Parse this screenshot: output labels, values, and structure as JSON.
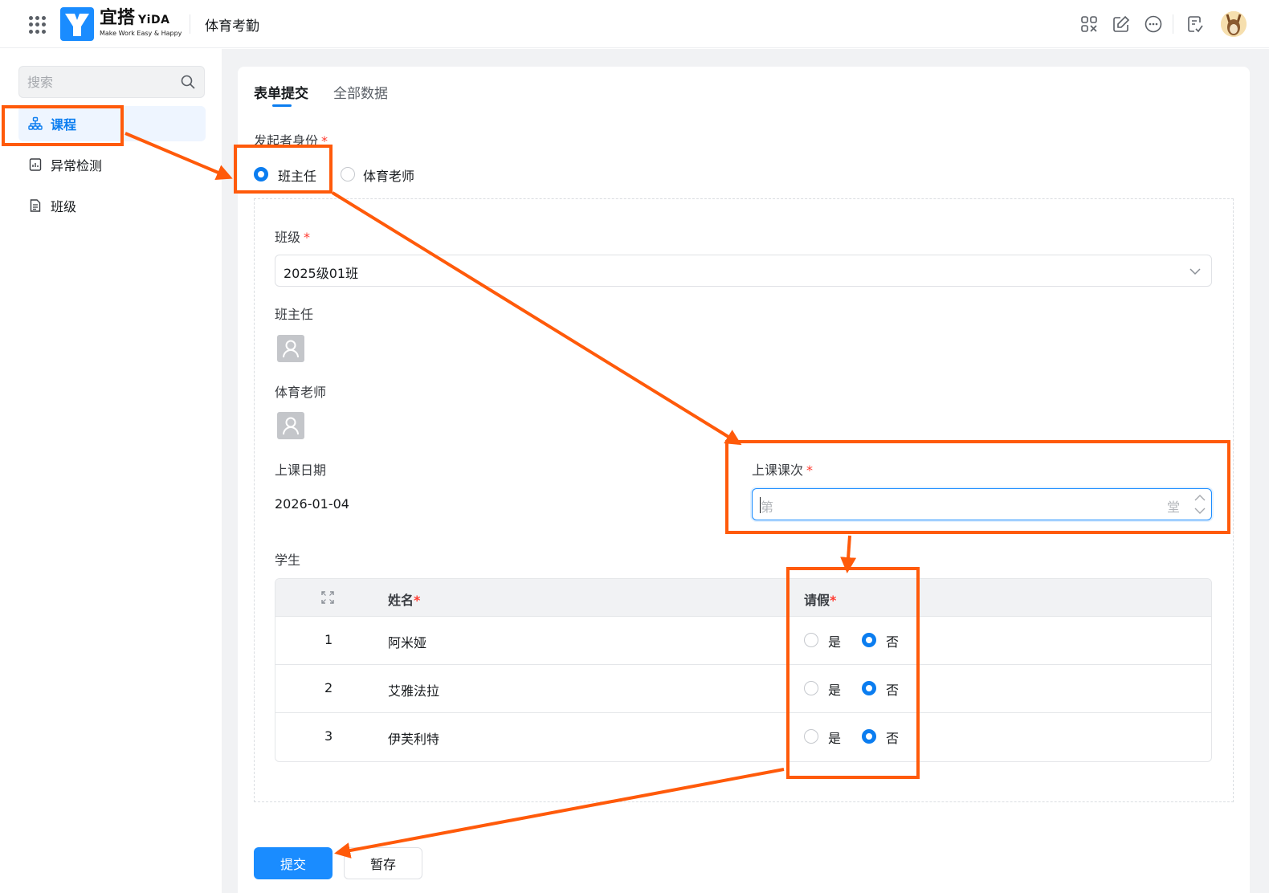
{
  "header": {
    "logo_cn": "宜搭",
    "logo_en": "YiDA",
    "logo_slogan": "Make Work Easy & Happy",
    "app_title": "体育考勤",
    "icons": [
      "grid-apps-icon",
      "qr-scan-icon",
      "edit-icon",
      "more-icon",
      "todo-icon",
      "avatar"
    ]
  },
  "sidebar": {
    "search_placeholder": "搜索",
    "items": [
      {
        "label": "课程",
        "icon": "org-chart-icon",
        "active": true
      },
      {
        "label": "异常检测",
        "icon": "report-icon",
        "active": false
      },
      {
        "label": "班级",
        "icon": "document-icon",
        "active": false
      }
    ]
  },
  "tabs": [
    {
      "label": "表单提交",
      "active": true
    },
    {
      "label": "全部数据",
      "active": false
    }
  ],
  "form": {
    "initiator_label": "发起者身份",
    "initiator_required": "*",
    "initiator_options": [
      {
        "label": "班主任",
        "selected": true
      },
      {
        "label": "体育老师",
        "selected": false
      }
    ],
    "class_label": "班级",
    "class_required": "*",
    "class_value": "2025级01班",
    "head_teacher_label": "班主任",
    "pe_teacher_label": "体育老师",
    "date_label": "上课日期",
    "date_value": "2026-01-04",
    "session_label": "上课课次",
    "session_required": "*",
    "session_prefix": "第",
    "session_suffix": "堂",
    "students_label": "学生",
    "table": {
      "col_name": "姓名",
      "col_leave": "请假",
      "required": "*",
      "yes": "是",
      "no": "否",
      "rows": [
        {
          "index": "1",
          "name": "阿米娅",
          "leave": "no"
        },
        {
          "index": "2",
          "name": "艾雅法拉",
          "leave": "no"
        },
        {
          "index": "3",
          "name": "伊芙利特",
          "leave": "no"
        }
      ]
    }
  },
  "buttons": {
    "submit": "提交",
    "save_draft": "暂存"
  },
  "colors": {
    "primary": "#1a8cff",
    "annotation": "#ff5a0a",
    "required": "#ff3b30"
  }
}
